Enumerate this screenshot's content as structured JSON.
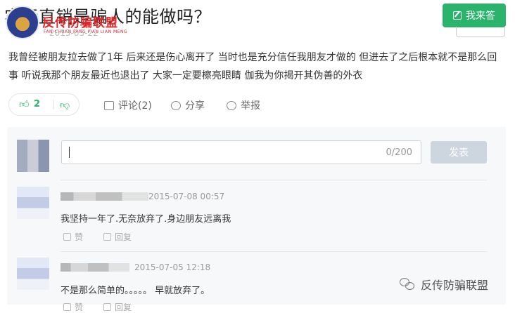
{
  "question": {
    "title": "实际直销是骗人的能做吗？",
    "date_partial": "2015-05-22",
    "answer_button": "我来答"
  },
  "logo": {
    "name": "反传防骗联盟",
    "subtitle": "FAN CHUAN FANG PIAN LIAN MENG"
  },
  "answer": {
    "text": "我曾经被朋友拉去做了1年 后来还是伤心离开了 当时也是充分信任我朋友才做的 但进去了之后根本就不是那么回事 听说我那个朋友最近也退出了 大家一定要檫亮眼睛 伽我为你揭开其伪善的外衣",
    "votes": "2",
    "comment_label": "评论(2)",
    "share_label": "分享",
    "report_label": "举报"
  },
  "comment_box": {
    "counter": "0/200",
    "submit_label": "发表"
  },
  "comments": [
    {
      "date": "2015-07-08 00:57",
      "text": "我坚持一年了.无奈放弃了.身边朋友远离我",
      "like": "赞",
      "reply": "回复"
    },
    {
      "date": "2015-07-05 12:18",
      "text": "不是那么简单的。。。。。 早就放弃了。",
      "like": "赞",
      "reply": "回复"
    }
  ],
  "watermark": "反传防骗联盟",
  "colors": {
    "accent": "#29b36b",
    "logo_red": "#e3262a",
    "panel_bg": "#f7f8fa"
  }
}
